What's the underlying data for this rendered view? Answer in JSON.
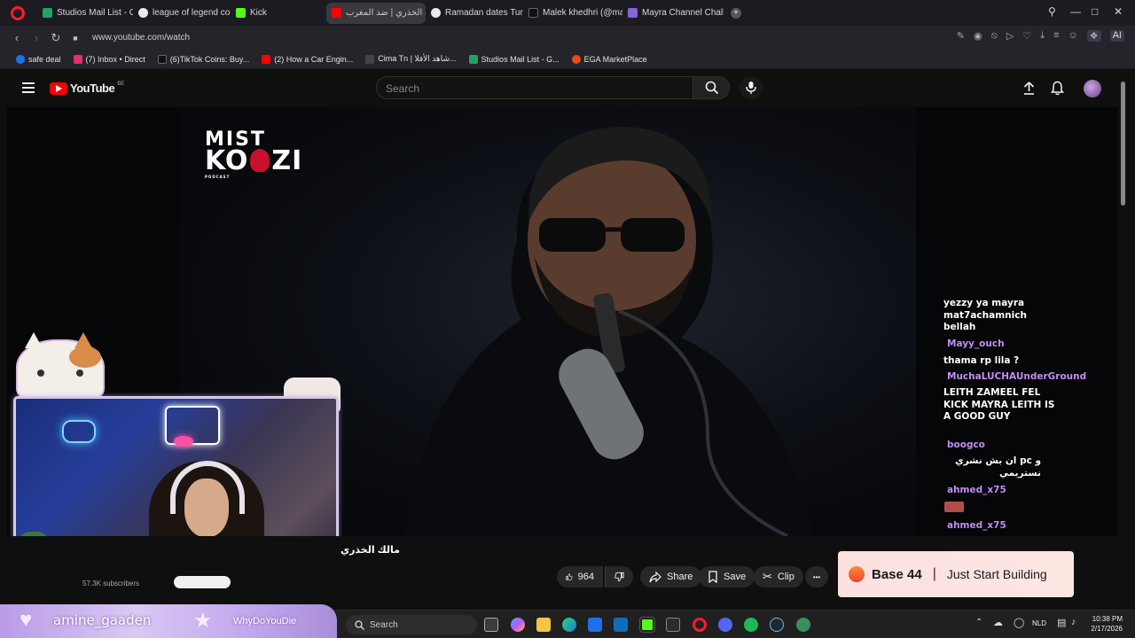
{
  "browser": {
    "tabs": [
      {
        "label": "Studios Mail List - Google",
        "color": "#21a366"
      },
      {
        "label": "league of legend competi",
        "color": "#e8eaed"
      },
      {
        "label": "Kick",
        "color": "#53fc18"
      },
      {
        "label": "مالك الخذري | ضد المغرب...",
        "color": "#ff0000",
        "active": true
      },
      {
        "label": "Ramadan dates Tunisia",
        "color": "#e8eaed"
      },
      {
        "label": "Malek khedhri (@malek_k",
        "color": "#111111"
      },
      {
        "label": "Mayra Channel Challenge",
        "color": "#8a63d2"
      }
    ],
    "new_tab": "+",
    "url": "www.youtube.com/watch",
    "bookmarks": [
      {
        "label": "safe deal",
        "color": "#1a73e8"
      },
      {
        "label": "(7) Inbox • Direct",
        "color": "#e1306c"
      },
      {
        "label": "(6)TikTok Coins: Buy...",
        "color": "#111111"
      },
      {
        "label": "(2) How a Car Engin...",
        "color": "#ff0000"
      },
      {
        "label": "Cima Tn | شاهد الأفلا...",
        "color": "#444444"
      },
      {
        "label": "Studios Mail List - G...",
        "color": "#21a366"
      },
      {
        "label": "EGA MarketPlace",
        "color": "#e64a19"
      }
    ],
    "ai_label": "AI"
  },
  "youtube": {
    "logo_text": "YouTube",
    "region": "BE",
    "search_placeholder": "Search"
  },
  "video": {
    "podcast_logo_line1": "MIST",
    "podcast_logo_line2": "KO",
    "podcast_logo_line2b": "ZI",
    "podcast_logo_sub": "PODCAST",
    "chat": [
      {
        "text": "yezzy ya mayra mat7achamnich bellah",
        "type": "msg"
      },
      {
        "text": "Mayy_ouch",
        "type": "name"
      },
      {
        "text": "thama rp lila ?",
        "type": "msg"
      },
      {
        "text": "MuchaLUCHAUnderGround",
        "type": "name"
      },
      {
        "text": "LEITH ZAMEEL FEL KICK MAYRA LEITH IS A GOOD GUY",
        "type": "msg"
      },
      {
        "text": "boogco",
        "type": "name"
      },
      {
        "text": "و pc ان بش نشري نستريمي",
        "type": "msg"
      },
      {
        "text": "ahmed_x75",
        "type": "name"
      },
      {
        "text": "ahmed_x75",
        "type": "name"
      }
    ]
  },
  "below": {
    "title_fragment": "مالك الخذري",
    "subscribers": "57.3K subscribers",
    "likes": "964",
    "share": "Share",
    "save": "Save",
    "clip": "Clip",
    "more": "•••"
  },
  "ad": {
    "brand": "Base 44",
    "separator": "|",
    "tagline": "Just Start Building"
  },
  "taskbar": {
    "streamer": "amine_gaaden",
    "viewer": "WhyDoYouDie",
    "search_placeholder": "Search",
    "language": "NLD",
    "time": "10:38 PM",
    "date": "2/17/2026"
  },
  "colors": {
    "youtube_red": "#ff0000",
    "chat_name": "#c58cf5",
    "ad_bg": "#fbe1df"
  }
}
